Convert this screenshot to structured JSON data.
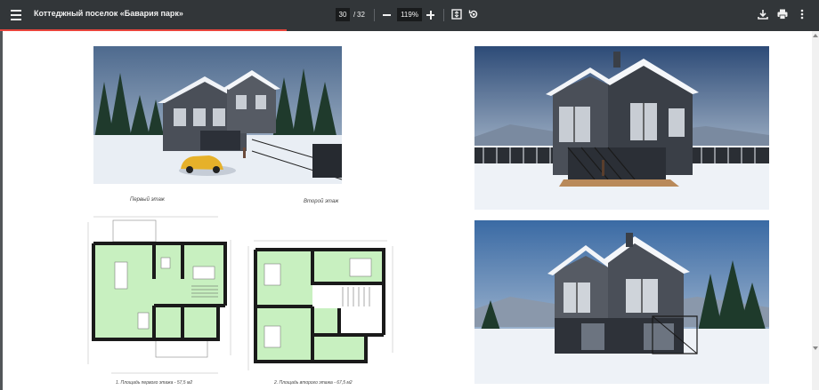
{
  "toolbar": {
    "menu_icon": "hamburger-menu-icon",
    "title": "Коттеджный поселок «Бавария парк»",
    "current_page": "30",
    "page_separator": "/",
    "total_pages": "32",
    "zoom_level": "119%",
    "icons": [
      "fit-page-icon",
      "rotate-icon",
      "download-icon",
      "print-icon",
      "more-vert-icon"
    ]
  },
  "progress": {
    "fraction": 0.35,
    "color": "#e8453c"
  },
  "document": {
    "plans": {
      "first_floor_caption": "Первый этаж",
      "second_floor_caption": "Второй этаж",
      "first_floor_area": "1. Площадь первого этажа - 57,5 м2",
      "second_floor_area": "2. Площадь второго этажа - 67,5 м2"
    }
  },
  "colors": {
    "toolbar_bg": "#323639",
    "viewer_bg": "#525659",
    "room_fill": "#c8f0c0",
    "wall": "#1a1a1a"
  }
}
